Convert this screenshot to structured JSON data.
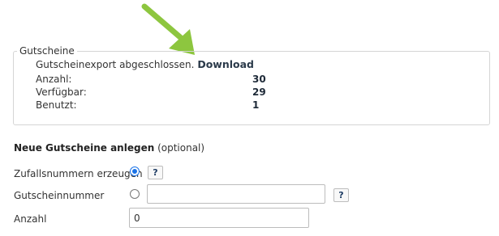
{
  "colors": {
    "arrow": "#8dc63f",
    "accent": "#1a73e8"
  },
  "voucher_box": {
    "legend": "Gutscheine",
    "export_text": "Gutscheinexport abgeschlossen.",
    "download_label": "Download",
    "stats": [
      {
        "label": "Anzahl:",
        "value": "30"
      },
      {
        "label": "Verfügbar:",
        "value": "29"
      },
      {
        "label": "Benutzt:",
        "value": "1"
      }
    ]
  },
  "create_section": {
    "title": "Neue Gutscheine anlegen",
    "optional": "(optional)",
    "random_label": "Zufallsnummern erzeugen",
    "random_selected": true,
    "number_label": "Gutscheinnummer",
    "number_value": "",
    "count_label": "Anzahl",
    "count_value": "0",
    "help_label": "?"
  }
}
